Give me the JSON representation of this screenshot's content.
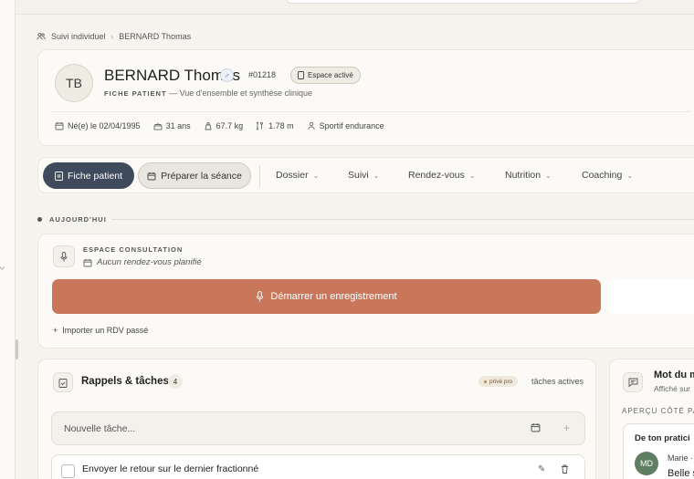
{
  "breadcrumb": {
    "root": "Suivi individuel",
    "current": "BERNARD Thomas"
  },
  "patient": {
    "initials": "TB",
    "name": "BERNARD Thomas",
    "gender_symbol": "♂",
    "id": "#01218",
    "espace_badge": "Espace activé",
    "subtitle_label": "FICHE PATIENT",
    "subtitle_text": "— Vue d'ensemble et synthèse clinique",
    "birth": "Né(e) le 02/04/1995",
    "age": "31 ans",
    "weight": "67.7 kg",
    "height": "1.78 m",
    "profile": "Sportif endurance"
  },
  "nav": {
    "primary": "Fiche patient",
    "secondary": "Préparer la séance",
    "items": [
      "Dossier",
      "Suivi",
      "Rendez-vous",
      "Nutrition",
      "Coaching"
    ]
  },
  "today": {
    "label": "AUJOURD'HUI"
  },
  "consultation": {
    "title": "ESPACE CONSULTATION",
    "subtitle": "Aucun rendez-vous planifié",
    "record_button": "Démarrer un enregistrement",
    "import": "Importer un RDV passé"
  },
  "tasks": {
    "title": "Rappels & tâches",
    "count": "4",
    "private_badge": "privé pro",
    "active_label": "tâches actives",
    "new_placeholder": "Nouvelle tâche...",
    "items": [
      "Envoyer le retour sur le dernier fractionné"
    ]
  },
  "mot": {
    "title": "Mot du m",
    "subtitle": "Affiché sur",
    "apercu": "APERÇU CÔTÉ PATI",
    "preview_title": "De ton pratici",
    "initials": "MD",
    "author": "Marie ·",
    "text": "Belle s"
  },
  "colors": {
    "primary_button": "#3f4a5c",
    "record_button": "#c9775b",
    "avatar_md": "#5f7d63"
  }
}
